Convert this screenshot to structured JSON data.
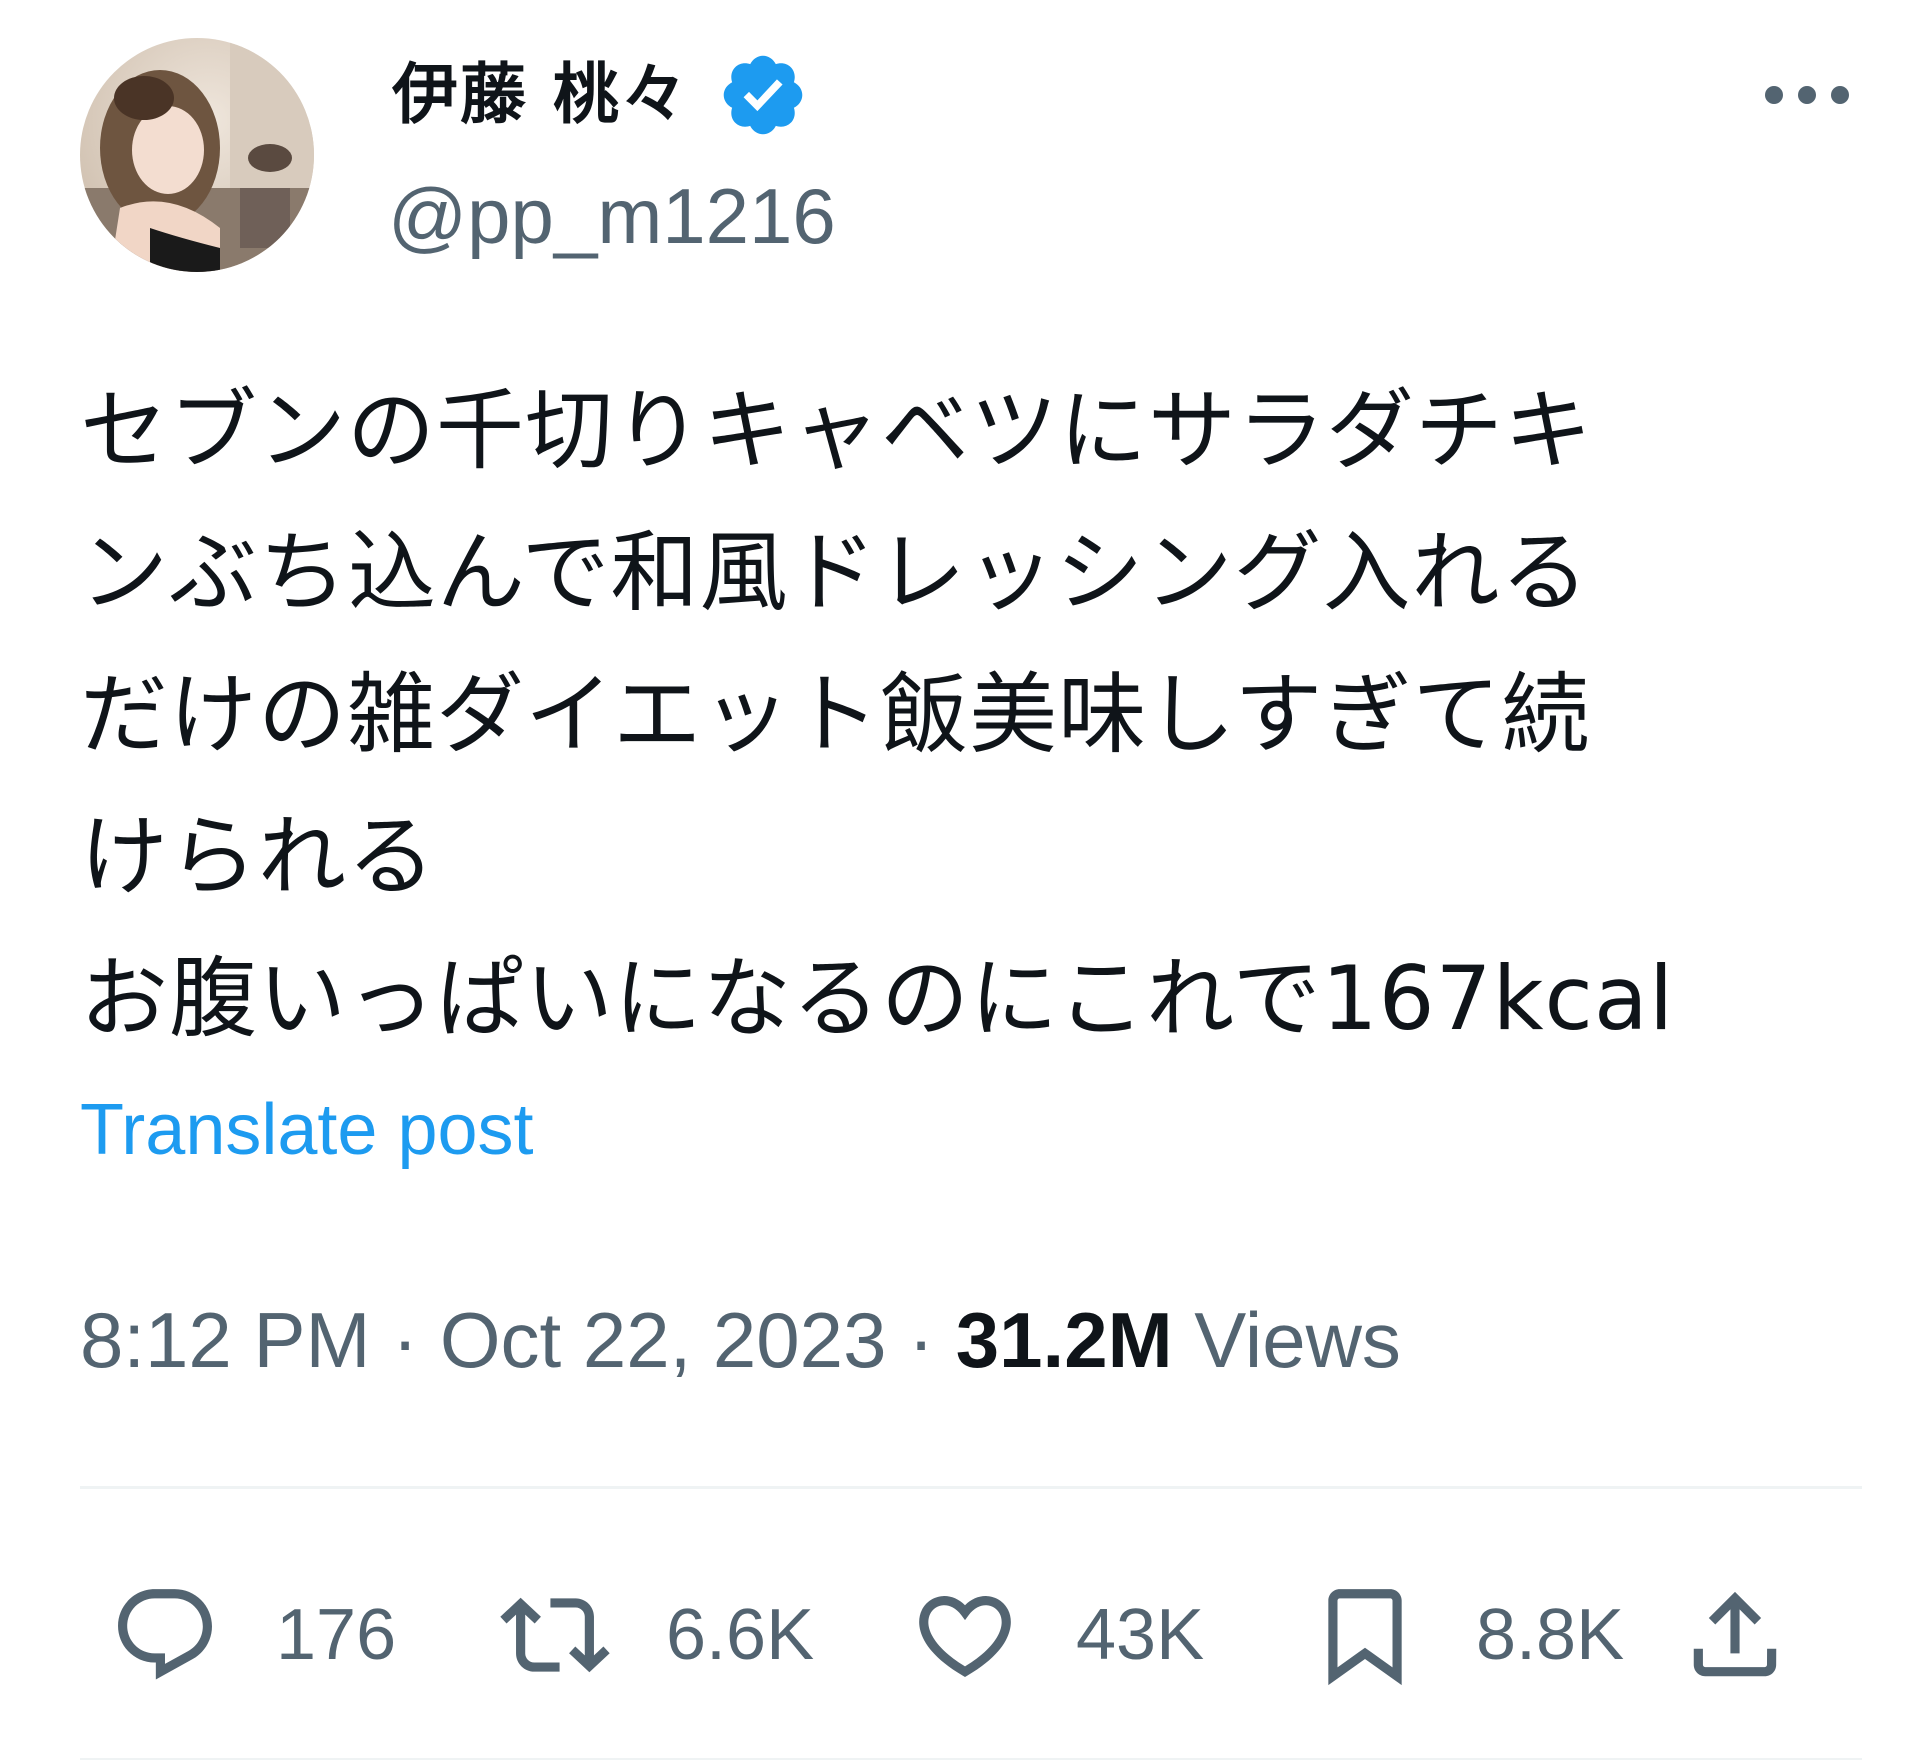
{
  "author": {
    "display_name": "伊藤 桃々",
    "handle": "@pp_m1216",
    "verified": true
  },
  "tweet": {
    "text_lines": [
      "セブンの千切りキャベツにサラダチキ",
      "ンぶち込んで和風ドレッシング入れる",
      "だけの雑ダイエット飯美味しすぎて続",
      "けられる",
      "お腹いっぱいになるのにこれで167kcal"
    ],
    "translate_label": "Translate post",
    "time": "8:12 PM",
    "separator": "·",
    "date": "Oct 22, 2023",
    "views_count": "31.2M",
    "views_label": "Views"
  },
  "actions": {
    "replies": "176",
    "reposts": "6.6K",
    "likes": "43K",
    "bookmarks": "8.8K"
  },
  "icons": {
    "more": "more-horizontal-icon",
    "verified": "verified-badge-icon",
    "reply": "reply-icon",
    "repost": "repost-icon",
    "like": "heart-icon",
    "bookmark": "bookmark-icon",
    "share": "share-icon"
  },
  "colors": {
    "text": "#0f1419",
    "secondary": "#536471",
    "link": "#1d9bf0",
    "verified": "#1d9bf0",
    "divider": "#eff3f4"
  }
}
